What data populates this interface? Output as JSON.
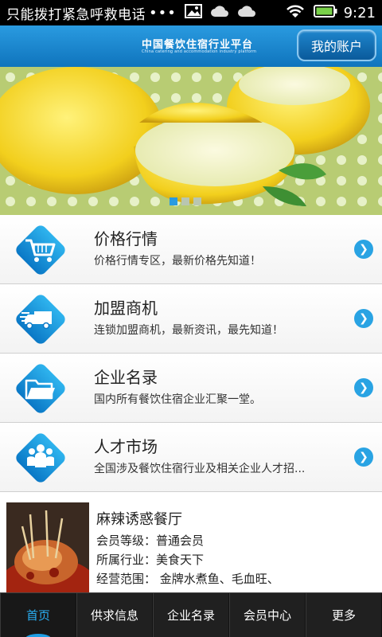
{
  "statusbar": {
    "notification_text": "只能拨打紧急呼救电话",
    "dots": "•••",
    "time": "9:21"
  },
  "header": {
    "logo_title": "中国餐饮住宿行业平台",
    "logo_subtitle": "China catering and accommodation industry platform",
    "account_button": "我的账户"
  },
  "banner": {
    "slide_count": 3,
    "active_slide": 1
  },
  "menu": {
    "items": [
      {
        "title": "价格行情",
        "desc": "价格行情专区，最新价格先知道！",
        "icon": "shopping-cart-icon"
      },
      {
        "title": "加盟商机",
        "desc": "连锁加盟商机，最新资讯，最先知道！",
        "icon": "delivery-truck-icon"
      },
      {
        "title": "企业名录",
        "desc": "国内所有餐饮住宿企业汇聚一堂。",
        "icon": "folder-icon"
      },
      {
        "title": "人才市场",
        "desc": "全国涉及餐饮住宿行业及相关企业人才招...",
        "icon": "people-group-icon"
      }
    ]
  },
  "card": {
    "name": "麻辣诱惑餐厅",
    "level": "会员等级：普通会员",
    "industry": "所属行业：美食天下",
    "scope": "经营范围： 金牌水煮鱼、毛血旺、"
  },
  "tabs": [
    "首页",
    "供求信息",
    "企业名录",
    "会员中心",
    "更多"
  ],
  "colors": {
    "accent": "#2a9be0",
    "header_blue": "#0f74bd",
    "tab_active": "#2ab0f5",
    "tabbar_bg": "#202020"
  }
}
